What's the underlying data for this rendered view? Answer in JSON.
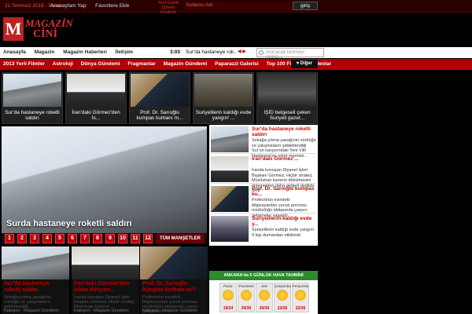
{
  "topbar": {
    "date": "31 Temmuz 2016 - Pazar",
    "links": [
      "Anasayfam Yap",
      "Favorilere Ekle"
    ],
    "uye": "Yeni Üyelik Şifremi Unuttum",
    "login_placeholder": "Kullanıcı Adı",
    "login_button": "giriş"
  },
  "logo": {
    "line1": "MAGAZİN",
    "line2": "CİNİ"
  },
  "nav": {
    "items": [
      "Anasayfa",
      "Magazin",
      "Magazin Haberleri",
      "İletişim"
    ],
    "clock": "3:03",
    "ticker": "Sur'da hastaneye rok...",
    "search_placeholder": "Aranacak kelimeyi giriniz..."
  },
  "categories": {
    "items": [
      "2013 Yerli Filmler",
      "Astroloji",
      "Dünya Gündemi",
      "Fragmanlar",
      "Magazin Gündemi",
      "Paparazzi Galerisi",
      "Top 100 Filmler",
      "Videolar"
    ],
    "more": "Diğer"
  },
  "strip": [
    {
      "caption": "Sur'da hastaneye roketli saldırı",
      "image": "roof"
    },
    {
      "caption": "İran'daki Görmez'den İs...",
      "image": "cleric"
    },
    {
      "caption": "Prof. Dr. Sarıoğlu kumpas kurbanı m...",
      "image": "fbi"
    },
    {
      "caption": "Suriyelilerin kaldığı evde yangın! ...",
      "image": "crowd"
    },
    {
      "caption": "IŞİD belgeseli çeken Suriyeli gazet...",
      "image": "isid"
    }
  ],
  "hero": {
    "title": "Surda hastaneye roketli saldırı",
    "pages": [
      "1",
      "2",
      "3",
      "4",
      "5",
      "6",
      "7",
      "8",
      "9",
      "10",
      "11",
      "12"
    ],
    "all_button": "TÜM MANŞETLER"
  },
  "side": [
    {
      "title": "Sur'da hastaneye roketli saldırı",
      "desc": "Sokağa çıkma yasağının sürdüğü ve çatışmaların şiddetlendiği Sur'un karşısındaki Yeni Viih Hastanesi'ne roket mermisi..."
    },
    {
      "title": "İran'daki Görmez'...",
      "desc": "İranda konuşan Diyanet İşleri Başkanı Görmez, Hiçbir strateji, Müslüman kanının dökülmesini önlemekten daha değerli değildir dedi."
    },
    {
      "title": "Prof. Dr. Sarıoğlu kumpas ku...",
      "desc": "Profesörün evindeki bilgisayardan çocuk pornosu müdürlüğü iddiasında çarpıcı gelişmeler yaşandı."
    },
    {
      "title": "Suriyelilerin kaldığı evde y...",
      "desc": "Suriyelilerin kaldığı evde yangın! 9 kişi dumandan etkilendi"
    }
  ],
  "cards": [
    {
      "title": "Sur'da hastaneye roketli saldırı",
      "desc": "Sokağa çıkma yasağının sürdüğü ve çatışmaların şiddetlendiği...",
      "kat": "Kategori : Magazin Gündemi"
    },
    {
      "title": "İran'daki Görmez'den İslam dünyası...",
      "desc": "İranda konuşan Diyanet İşleri Başkanı Görmez, Hiçbir strateji, Müslüman kanının...",
      "kat": "Kategori : Magazin Gündemi"
    },
    {
      "title": "Prof. Dr. Sarıoğlu kumpas kurbanı mı?",
      "desc": "Profesörün evindeki bilgisayardan çocuk pornosu müdürlüğü iddiasında çarpıcı gelişmeler...",
      "kat": "Kategori : Magazin Gündemi"
    }
  ],
  "weather": {
    "title": "ANKARA'da 5 GÜNLÜK HAVA TAHMİNİ",
    "days": [
      {
        "name": "Pazar",
        "temp": "19/34"
      },
      {
        "name": "Pazartesi",
        "temp": "20/36"
      },
      {
        "name": "Salı",
        "temp": "20/36"
      },
      {
        "name": "Çarşamba",
        "temp": "22/36"
      },
      {
        "name": "Perşembe",
        "temp": "22/36"
      }
    ]
  },
  "colors": {
    "brand": "#b50000",
    "accent": "#cc0000",
    "weather": "#2d8a2d"
  }
}
